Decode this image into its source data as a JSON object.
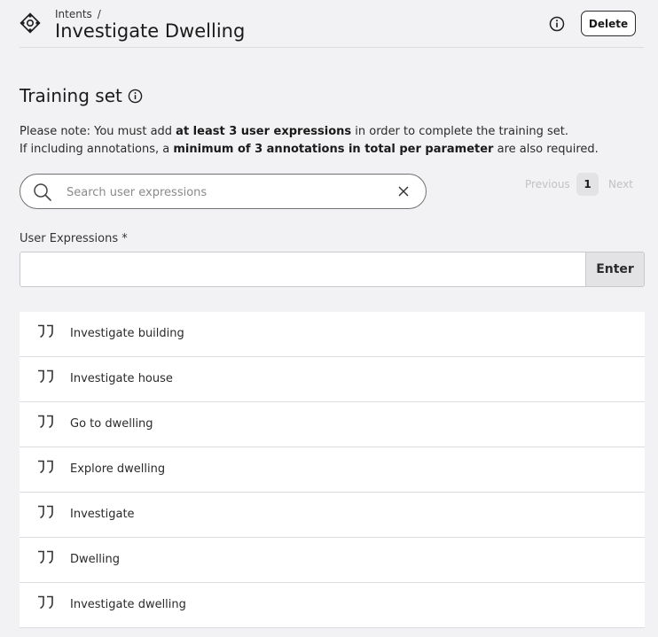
{
  "header": {
    "breadcrumb": "Intents",
    "breadcrumb_separator": "/",
    "title": "Investigate Dwelling",
    "delete_label": "Delete"
  },
  "training": {
    "title": "Training set",
    "note_line1": {
      "pre": "Please note: You must add ",
      "bold": "at least 3 user expressions",
      "post": " in order to complete the training set."
    },
    "note_line2": {
      "pre": "If including annotations, a ",
      "bold": "minimum of 3 annotations in total per parameter",
      "post": " are also required."
    }
  },
  "search": {
    "placeholder": "Search user expressions",
    "value": ""
  },
  "pagination": {
    "previous_label": "Previous",
    "current_page": "1",
    "next_label": "Next"
  },
  "user_expressions": {
    "label": "User Expressions *",
    "input_value": "",
    "enter_label": "Enter"
  },
  "expressions": [
    {
      "text": "Investigate building"
    },
    {
      "text": "Investigate house"
    },
    {
      "text": "Go to dwelling"
    },
    {
      "text": "Explore dwelling"
    },
    {
      "text": "Investigate"
    },
    {
      "text": "Dwelling"
    },
    {
      "text": "Investigate dwelling"
    }
  ],
  "icons": {
    "intent": "intent-icon",
    "info": "info-icon",
    "search": "search-icon",
    "clear": "close-icon",
    "quote": "quote-icon"
  },
  "colors": {
    "background": "#f2f2f4",
    "surface": "#ffffff",
    "text": "#1f1f1f",
    "muted": "#c2c2c6",
    "border": "#dcdcdf"
  }
}
